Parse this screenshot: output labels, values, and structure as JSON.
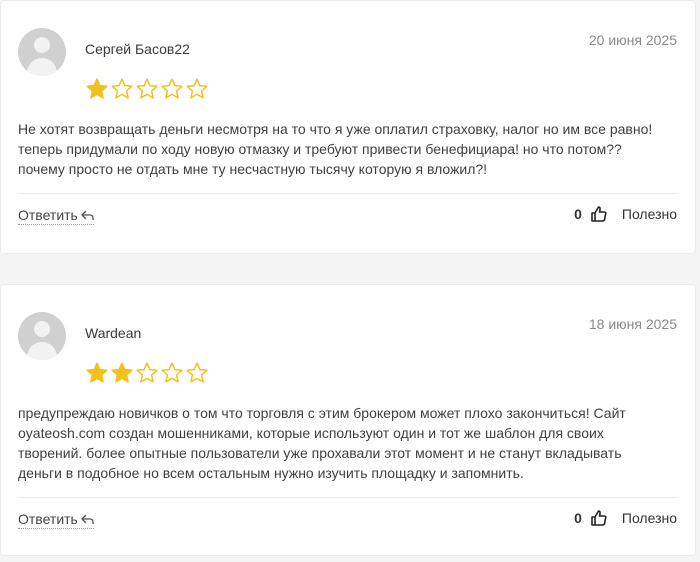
{
  "reviews": [
    {
      "author": "Сергей Басов22",
      "date": "20 июня 2025",
      "rating": 1,
      "rating_max": 5,
      "text": "Не хотят возвращать деньги несмотря на то что я уже оплатил страховку, налог но им все равно! теперь придумали по ходу новую отмазку и требуют привести бенефициара! но что потом??почему просто не отдать мне ту несчастную тысячу которую я вложил?!",
      "reply_label": "Ответить",
      "likes": "0",
      "helpful_label": "Полезно"
    },
    {
      "author": "Wardean",
      "date": "18 июня 2025",
      "rating": 2,
      "rating_max": 5,
      "text": "предупреждаю новичков о том что торговля с этим брокером может плохо закончиться! Сайт oyateosh.com создан мошенниками, которые используют один и тот же шаблон для своих творений. более опытные пользователи уже прохавали этот момент и не станут вкладывать деньги в подобное но всем остальным нужно изучить площадку и запомнить.",
      "reply_label": "Ответить",
      "likes": "0",
      "helpful_label": "Полезно"
    }
  ],
  "icons": {
    "avatar": "user-avatar-icon",
    "reply": "reply-arrow-icon",
    "like": "thumbs-up-icon",
    "star": "star-icon"
  },
  "colors": {
    "star_filled": "#f2c11c",
    "star_empty": "#f2c11c"
  }
}
